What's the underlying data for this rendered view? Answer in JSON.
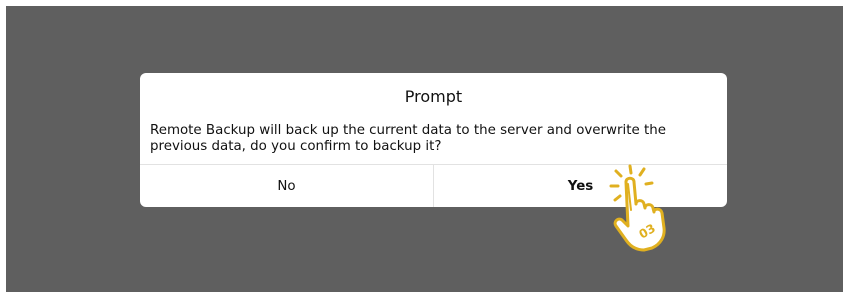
{
  "dialog": {
    "title": "Prompt",
    "message": "Remote Backup will back up the current data to the server and overwrite the previous data, do you confirm to backup it?",
    "no_label": "No",
    "yes_label": "Yes"
  },
  "step_marker": {
    "icon": "tap-hand-icon",
    "step_number": "03",
    "color": "#e0b020"
  }
}
